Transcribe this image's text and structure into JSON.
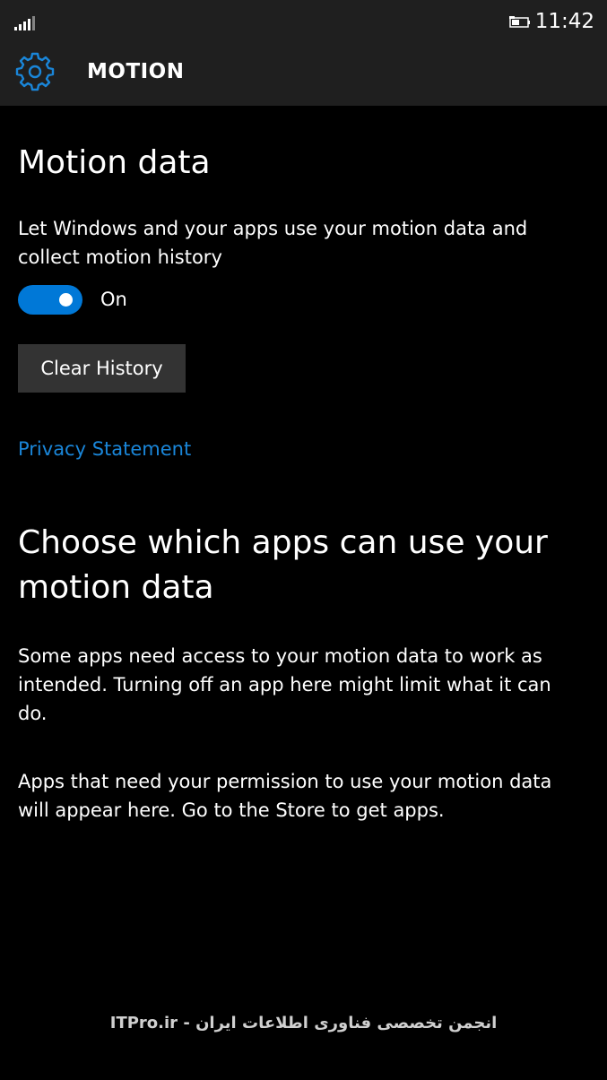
{
  "status_bar": {
    "signal_icon": "signal-bars-icon",
    "battery_icon": "battery-charging-icon",
    "time": "11:42"
  },
  "header": {
    "icon": "gear-icon",
    "title": "MOTION"
  },
  "motion_section": {
    "title": "Motion data",
    "description": "Let Windows and your apps use your motion data and collect motion history",
    "toggle": {
      "state": "on",
      "label": "On"
    },
    "clear_button_label": "Clear History",
    "privacy_link_label": "Privacy Statement"
  },
  "apps_section": {
    "title": "Choose which apps can use your motion data",
    "paragraph1": "Some apps need access to your motion data to work as intended. Turning off an app here might limit what it can do.",
    "paragraph2": "Apps that need your permission to use your motion data will appear here. Go to the Store to get apps."
  },
  "watermark": "ITPro.ir - انجمن تخصصی فناوری اطلاعات ایران",
  "colors": {
    "accent": "#0078d7",
    "link": "#1a86d9",
    "background": "#000000",
    "chrome": "#1f1f1f",
    "button": "#333333"
  }
}
